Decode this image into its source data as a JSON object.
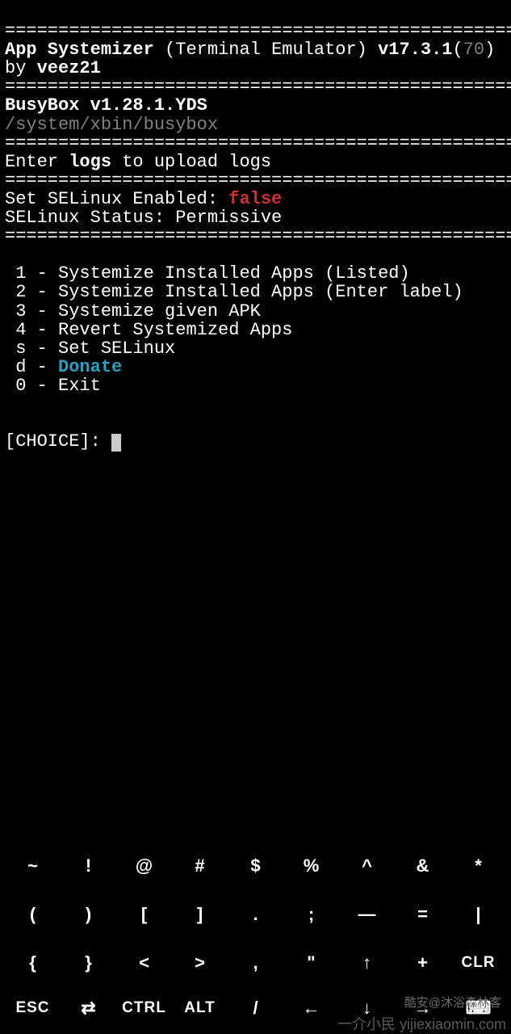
{
  "divider": "=================================================",
  "header": {
    "app_name": "App Systemizer ",
    "context": "(Terminal Emulator) ",
    "version": "v17.3.1",
    "build_open": "(",
    "build": "70",
    "build_close": ")",
    "by": "by ",
    "author": "veez21"
  },
  "busybox": {
    "label": "BusyBox ",
    "version": "v1.28.1.YDS",
    "path": "/system/xbin/busybox"
  },
  "logs": {
    "pre": "Enter ",
    "cmd": "logs",
    "post": " to upload logs"
  },
  "selinux": {
    "set_label": "Set SELinux Enabled: ",
    "set_value": "false",
    "status_label": "SELinux Status: ",
    "status_value": "Permissive"
  },
  "menu": [
    {
      "key": " 1 - ",
      "label": "Systemize Installed Apps (Listed)"
    },
    {
      "key": " 2 - ",
      "label": "Systemize Installed Apps (Enter label)"
    },
    {
      "key": " 3 - ",
      "label": "Systemize given APK"
    },
    {
      "key": " 4 - ",
      "label": "Revert Systemized Apps"
    },
    {
      "key": " s - ",
      "label": "Set SELinux"
    },
    {
      "key": " d - ",
      "label": "Donate",
      "highlight": true
    },
    {
      "key": " 0 - ",
      "label": "Exit"
    }
  ],
  "prompt": "[CHOICE]: ",
  "keyboard": {
    "row1": [
      "~",
      "!",
      "@",
      "#",
      "$",
      "%",
      "^",
      "&",
      "*"
    ],
    "row2": [
      "(",
      ")",
      "[",
      "]",
      ".",
      ";",
      "—",
      "=",
      "|"
    ],
    "row3": [
      "{",
      "}",
      "<",
      ">",
      ",",
      "\"",
      "↑",
      "+",
      "CLR"
    ],
    "row4": [
      "ESC",
      "⇄",
      "CTRL",
      "ALT",
      "/",
      "←",
      "↓",
      "→",
      "⌨"
    ]
  },
  "watermark_top": "酷安@沐浴森林客",
  "watermark_bottom": "一介小民 yijiexiaomin.com"
}
